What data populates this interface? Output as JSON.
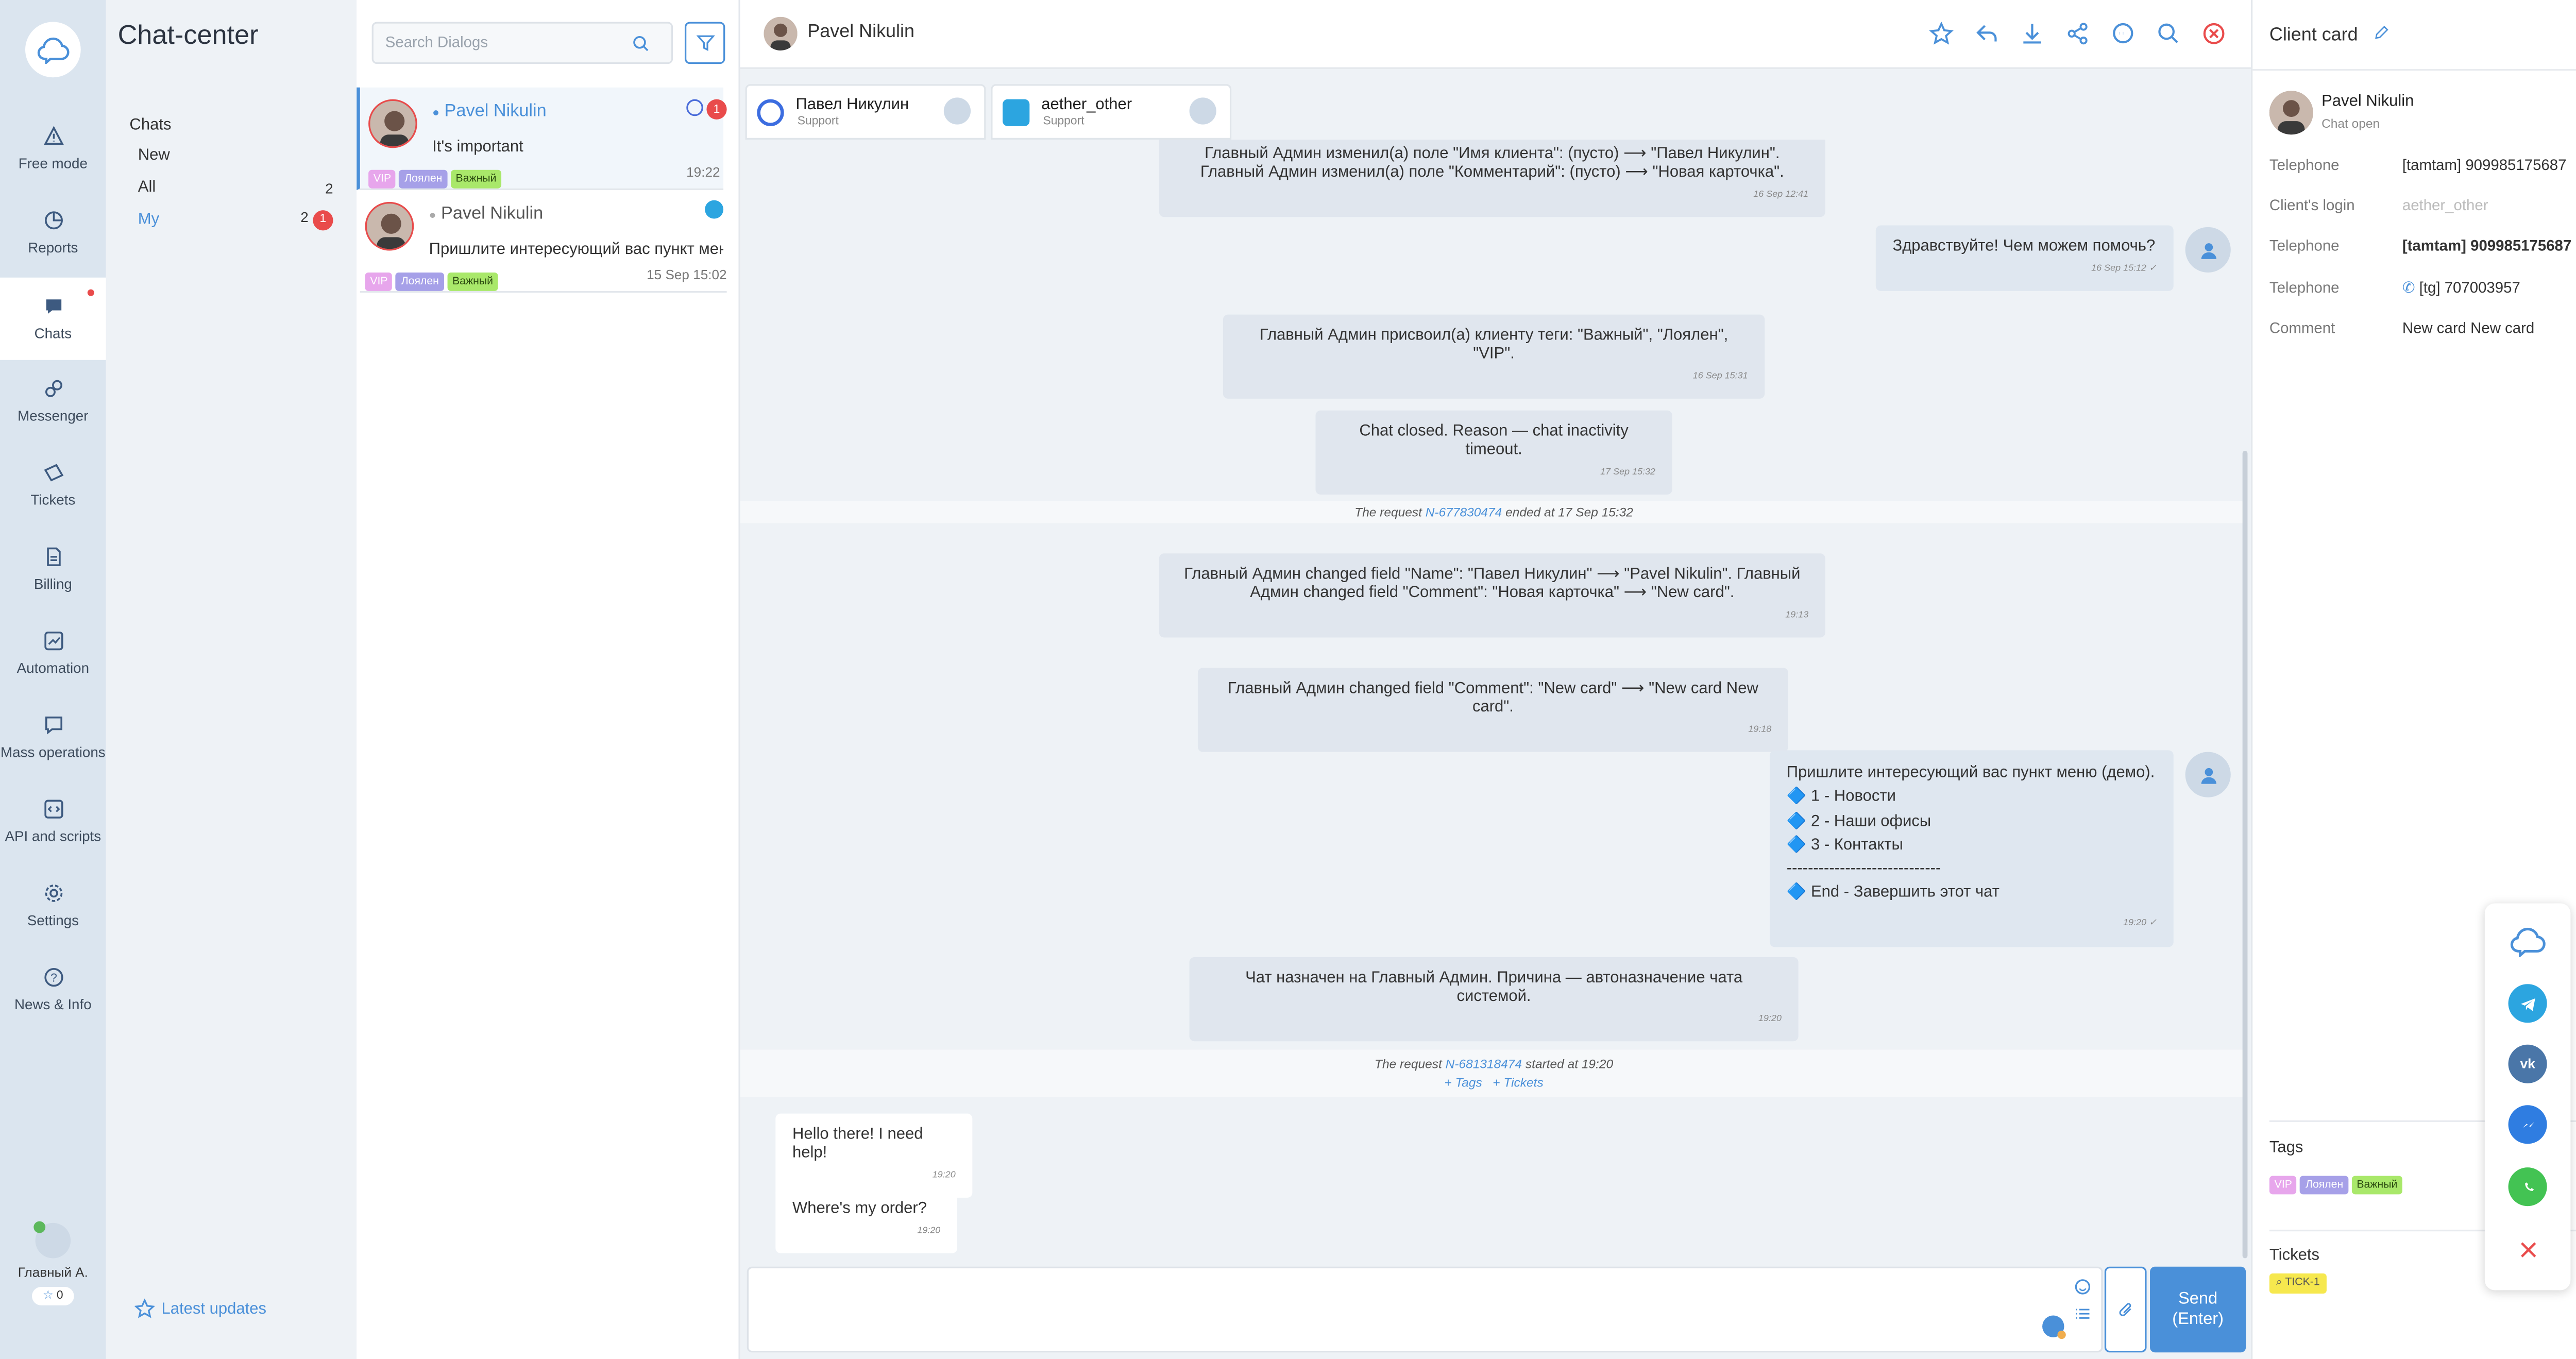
{
  "nav": {
    "title": "Chat-center",
    "section": "Chats",
    "items": [
      {
        "label": "New",
        "count": ""
      },
      {
        "label": "All",
        "count": "2"
      },
      {
        "label": "My",
        "count": "2",
        "badge": "1"
      }
    ],
    "latest_updates": "Latest updates"
  },
  "rail": {
    "items": [
      {
        "label": "Free mode",
        "icon": "warning-icon"
      },
      {
        "label": "Reports",
        "icon": "pie-chart-icon"
      },
      {
        "label": "Chats",
        "icon": "chat-icon"
      },
      {
        "label": "Messenger",
        "icon": "link-icon"
      },
      {
        "label": "Tickets",
        "icon": "ticket-icon"
      },
      {
        "label": "Billing",
        "icon": "document-icon"
      },
      {
        "label": "Automation",
        "icon": "image-chart-icon"
      },
      {
        "label": "Mass operations",
        "icon": "broadcast-icon"
      },
      {
        "label": "API and scripts",
        "icon": "code-icon"
      },
      {
        "label": "Settings",
        "icon": "gear-icon"
      },
      {
        "label": "News & Info",
        "icon": "question-icon"
      }
    ],
    "user_name": "Главный А.",
    "user_stars": "0"
  },
  "dialogs": {
    "search_placeholder": "Search Dialogs",
    "items": [
      {
        "name": "Pavel Nikulin",
        "message": "It's important",
        "time": "19:22",
        "badge": "1",
        "tags": [
          "VIP",
          "Лоялен",
          "Важный"
        ]
      },
      {
        "name": "Pavel Nikulin",
        "message": "Пришлите интересующий вас пункт меню (демо).",
        "time": "15 Sep 15:02",
        "tags": [
          "VIP",
          "Лоялен",
          "Важный"
        ]
      }
    ]
  },
  "chat": {
    "header_name": "Pavel Nikulin",
    "channels": [
      {
        "name": "Павел Никулин",
        "role": "Support"
      },
      {
        "name": "aether_other",
        "role": "Support"
      }
    ],
    "messages": {
      "m1_line1": "Главный Админ изменил(а) поле \"Имя клиента\": (пусто) ⟶ \"Павел Никулин\".",
      "m1_line2": "Главный Админ изменил(а) поле \"Комментарий\": (пусто) ⟶ \"Новая карточка\".",
      "m1_time": "16 Sep 12:41",
      "m2_text": "Здравствуйте! Чем можем помочь?",
      "m2_time": "16 Sep 15:12",
      "m3_text": "Главный Админ присвоил(а) клиенту теги: \"Важный\", \"Лоялен\", \"VIP\".",
      "m3_time": "16 Sep 15:31",
      "m4_text": "Chat closed. Reason — chat inactivity timeout.",
      "m4_time": "17 Sep 15:32",
      "sys1_pre": "The request",
      "sys1_link": "N-677830474",
      "sys1_post": "ended at 17 Sep 15:32",
      "m5_line1": "Главный Админ changed field \"Name\": \"Павел Никулин\" ⟶ \"Pavel Nikulin\". Главный",
      "m5_line2": "Админ changed field \"Comment\": \"Новая карточка\" ⟶ \"New card\".",
      "m5_time": "19:13",
      "m6_text": "Главный Админ changed field \"Comment\": \"New card\" ⟶ \"New card New card\".",
      "m6_time": "19:18",
      "m7_line1": "Пришлите интересующий вас пункт меню (демо).",
      "m7_line2": "🔷 1 - Новости",
      "m7_line3": "🔷 2 - Наши офисы",
      "m7_line4": "🔷 3 - Контакты",
      "m7_line5": "-----------------------------",
      "m7_line6": "🔷 End - Завершить этот чат",
      "m7_time": "19:20",
      "m8_text": "Чат назначен на Главный Админ. Причина — автоназначение чата системой.",
      "m8_time": "19:20",
      "sys2_pre": "The request",
      "sys2_link": "N-681318474",
      "sys2_post": "started at 19:20",
      "sys2_tags": "+ Tags",
      "sys2_tickets": "+ Tickets",
      "m9_text": "Hello there! I need help!",
      "m9_time": "19:20",
      "m10_text": "Where's my order?",
      "m10_time": "19:20"
    },
    "send_label": "Send",
    "send_hint": "(Enter)"
  },
  "card": {
    "title": "Client card",
    "name": "Pavel Nikulin",
    "status": "Chat open",
    "fields": [
      {
        "label": "Telephone",
        "value": "[tamtam] 909985175687"
      },
      {
        "label": "Client's login",
        "value": "aether_other"
      },
      {
        "label": "Telephone",
        "value": "[tamtam] 909985175687"
      },
      {
        "label": "Telephone",
        "value": "[tg] 707003957"
      },
      {
        "label": "Comment",
        "value": "New card New card"
      }
    ],
    "tags_title": "Tags",
    "tags": [
      "VIP",
      "Лоялен",
      "Важный"
    ],
    "tickets_title": "Tickets",
    "ticket": "TICK-1"
  },
  "colors": {
    "accent": "#4a90d9",
    "danger": "#e94b4b",
    "rail": "#dbe5ef"
  }
}
